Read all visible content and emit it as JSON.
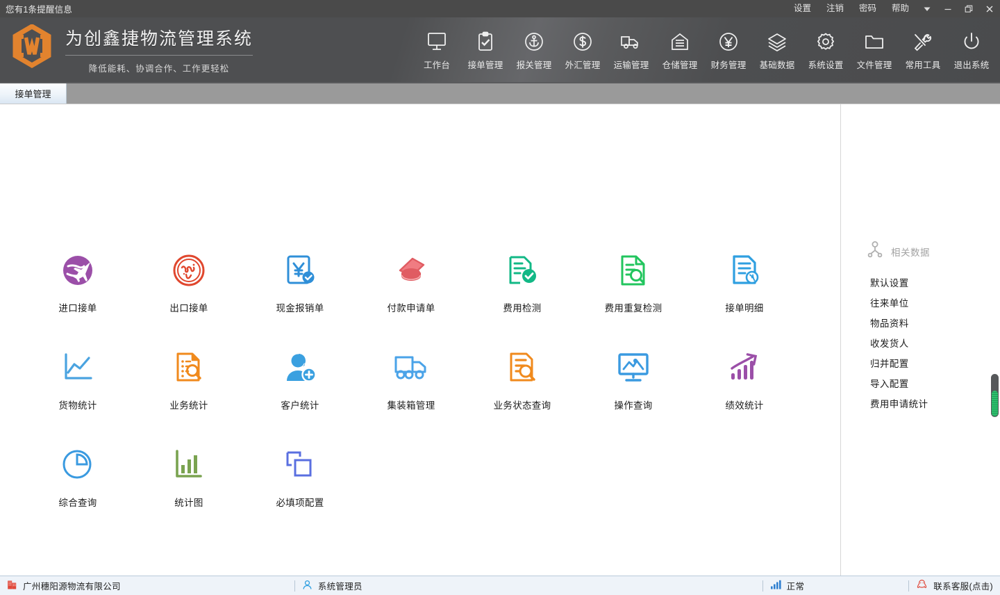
{
  "titlebar": {
    "notice": "您有1条提醒信息",
    "links": [
      {
        "label": "设置",
        "name": "settings"
      },
      {
        "label": "注销",
        "name": "logout"
      },
      {
        "label": "密码",
        "name": "password"
      },
      {
        "label": "帮助",
        "name": "help"
      }
    ],
    "window_buttons": [
      {
        "name": "dropdown-icon",
        "glyph": "▼"
      },
      {
        "name": "minimize-icon",
        "glyph": "—"
      },
      {
        "name": "maximize-icon",
        "glyph": "❐"
      },
      {
        "name": "close-icon",
        "glyph": "✕"
      }
    ]
  },
  "brand": {
    "logo_letter": "W",
    "title": "为创鑫捷物流管理系统",
    "subtitle": "降低能耗、协调合作、工作更轻松",
    "logo_color": "#e2832e"
  },
  "toolbar": {
    "items": [
      {
        "label": "工作台",
        "icon": "monitor-icon"
      },
      {
        "label": "接单管理",
        "icon": "clipboard-check-icon"
      },
      {
        "label": "报关管理",
        "icon": "anchor-circle-icon"
      },
      {
        "label": "外汇管理",
        "icon": "dollar-circle-icon"
      },
      {
        "label": "运输管理",
        "icon": "truck-icon"
      },
      {
        "label": "仓储管理",
        "icon": "warehouse-icon"
      },
      {
        "label": "财务管理",
        "icon": "yuan-circle-icon"
      },
      {
        "label": "基础数据",
        "icon": "layers-icon"
      },
      {
        "label": "系统设置",
        "icon": "gear-icon"
      },
      {
        "label": "文件管理",
        "icon": "folder-icon"
      },
      {
        "label": "常用工具",
        "icon": "tools-icon"
      },
      {
        "label": "退出系统",
        "icon": "power-icon"
      }
    ]
  },
  "tabs": [
    {
      "label": "接单管理",
      "active": true
    }
  ],
  "apps": [
    {
      "label": "进口接单",
      "icon": "plane-globe-icon",
      "color": "#9b4fa8"
    },
    {
      "label": "出口接单",
      "icon": "globe-circle-icon",
      "color": "#e0472e"
    },
    {
      "label": "现金报销单",
      "icon": "yuan-doc-check-icon",
      "color": "#2f8fd8"
    },
    {
      "label": "付款申请单",
      "icon": "coins-card-icon",
      "color": "#e05c62"
    },
    {
      "label": "费用检测",
      "icon": "doc-check-icon",
      "color": "#12b886"
    },
    {
      "label": "费用重复检测",
      "icon": "doc-search-icon",
      "color": "#22c55e"
    },
    {
      "label": "接单明细",
      "icon": "doc-in-icon",
      "color": "#2f9fe0"
    },
    {
      "label": "货物统计",
      "icon": "line-chart-icon",
      "color": "#4aa3e0"
    },
    {
      "label": "业务统计",
      "icon": "doc-list-search-icon",
      "color": "#f08a1d"
    },
    {
      "label": "客户统计",
      "icon": "user-add-icon",
      "color": "#3aa0e0"
    },
    {
      "label": "集装箱管理",
      "icon": "container-truck-icon",
      "color": "#4aa3e8"
    },
    {
      "label": "业务状态查询",
      "icon": "doc-query-icon",
      "color": "#f08a1d"
    },
    {
      "label": "操作查询",
      "icon": "monitor-chart-icon",
      "color": "#3a9ae0"
    },
    {
      "label": "绩效统计",
      "icon": "growth-arrow-icon",
      "color": "#9b4fa8"
    },
    {
      "label": "综合查询",
      "icon": "pie-chart-icon",
      "color": "#3a9ae0"
    },
    {
      "label": "统计图",
      "icon": "bar-chart-icon",
      "color": "#7aa350"
    },
    {
      "label": "必填项配置",
      "icon": "copy-squares-icon",
      "color": "#5a6fe0"
    }
  ],
  "right_panel": {
    "header": "相关数据",
    "header_icon": "user-network-icon",
    "items": [
      {
        "label": "默认设置"
      },
      {
        "label": "往来单位"
      },
      {
        "label": "物品资料"
      },
      {
        "label": "收发货人"
      },
      {
        "label": "归并配置"
      },
      {
        "label": "导入配置"
      },
      {
        "label": "费用申请统计"
      }
    ]
  },
  "statusbar": {
    "company": "广州穗阳源物流有限公司",
    "company_icon": "building-icon",
    "user": "系统管理员",
    "user_icon": "person-icon",
    "network_status": "正常",
    "network_icon": "signal-bars-icon",
    "support": "联系客服(点击)",
    "support_icon": "qq-penguin-icon"
  }
}
